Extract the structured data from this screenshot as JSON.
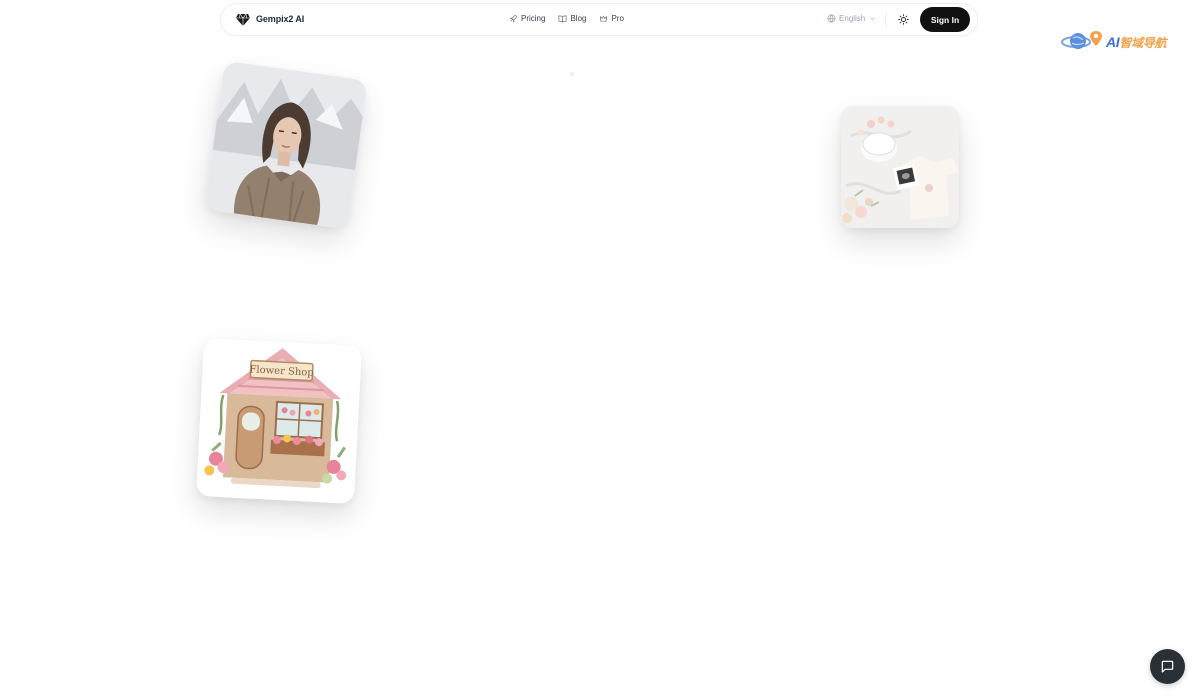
{
  "header": {
    "brand": "Gempix2 AI",
    "nav": [
      {
        "label": "Pricing",
        "icon": "rocket-icon"
      },
      {
        "label": "Blog",
        "icon": "book-icon"
      },
      {
        "label": "Pro",
        "icon": "crown-icon"
      }
    ],
    "language": "English",
    "sign_in": "Sign In"
  },
  "watermark": {
    "latin": "AI",
    "cjk": "智域导航"
  },
  "cards": [
    {
      "name": "portrait-card",
      "subject": "woman in fur coat"
    },
    {
      "name": "baby-announcement-card",
      "subject": "baby onesie and cake"
    },
    {
      "name": "flower-shop-card",
      "sign_text": "Flower Shop"
    }
  ],
  "colors": {
    "accent": "#111111",
    "text": "#1f2937",
    "muted": "#9ca3af",
    "watermark_blue": "#3f6fd6",
    "watermark_orange": "#f2a24a"
  }
}
